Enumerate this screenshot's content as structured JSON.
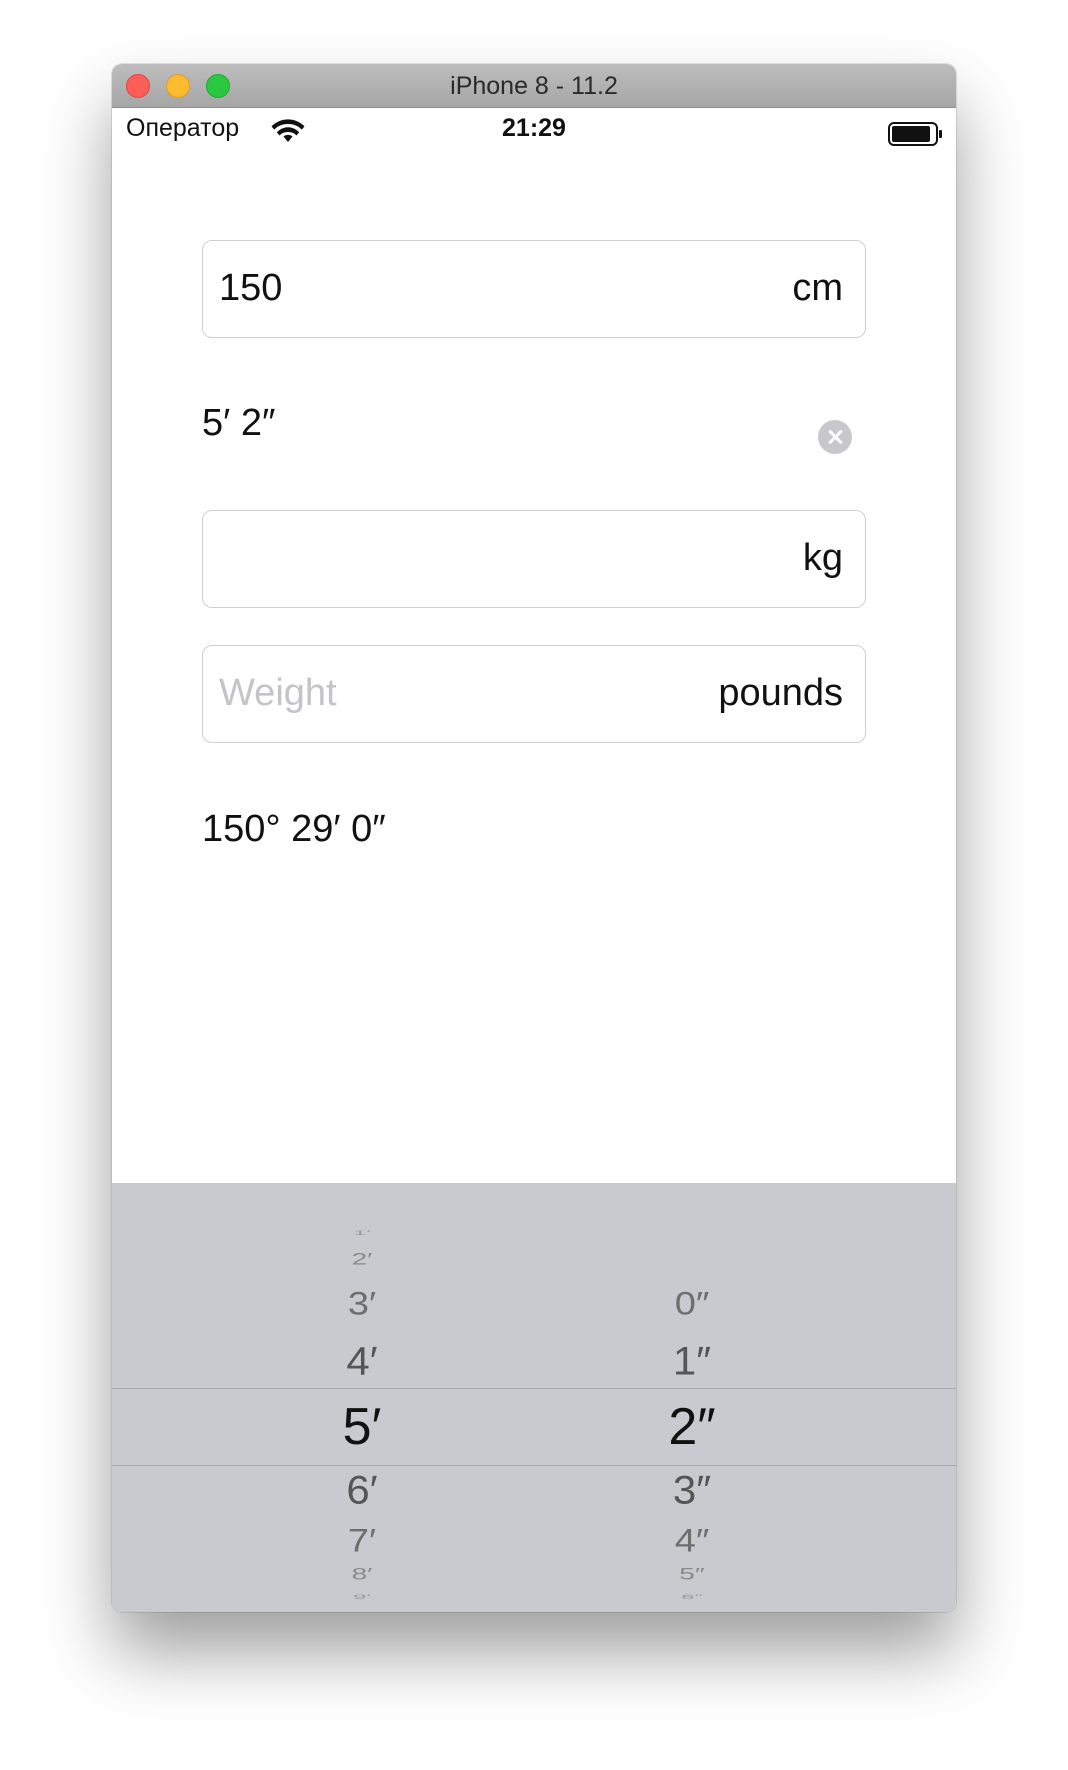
{
  "window": {
    "title": "iPhone 8 - 11.2"
  },
  "status_bar": {
    "carrier": "Оператор",
    "time": "21:29",
    "icons": [
      "wifi-icon",
      "battery-icon"
    ]
  },
  "height_cm_field": {
    "value": "150",
    "unit": "cm"
  },
  "height_feet_display": {
    "value": "5′ 2″"
  },
  "weight_kg_field": {
    "value": "",
    "unit": "kg"
  },
  "weight_pounds_field": {
    "value": "",
    "placeholder": "Weight",
    "unit": "pounds"
  },
  "angle_display": {
    "value": "150° 29′ 0″"
  },
  "picker": {
    "feet_column": [
      "1′",
      "2′",
      "3′",
      "4′",
      "5′",
      "6′",
      "7′",
      "8′",
      "9′"
    ],
    "inches_column": [
      "",
      "",
      "0″",
      "1″",
      "2″",
      "3″",
      "4″",
      "5″",
      "6″"
    ],
    "selected_feet": "5′",
    "selected_inches": "2″"
  },
  "colors": {
    "traffic_close": "#fc5f57",
    "traffic_minimize": "#fdbb2e",
    "traffic_zoom": "#2ac840",
    "picker_background": "#c8cad0",
    "placeholder": "#c4c4c8"
  }
}
